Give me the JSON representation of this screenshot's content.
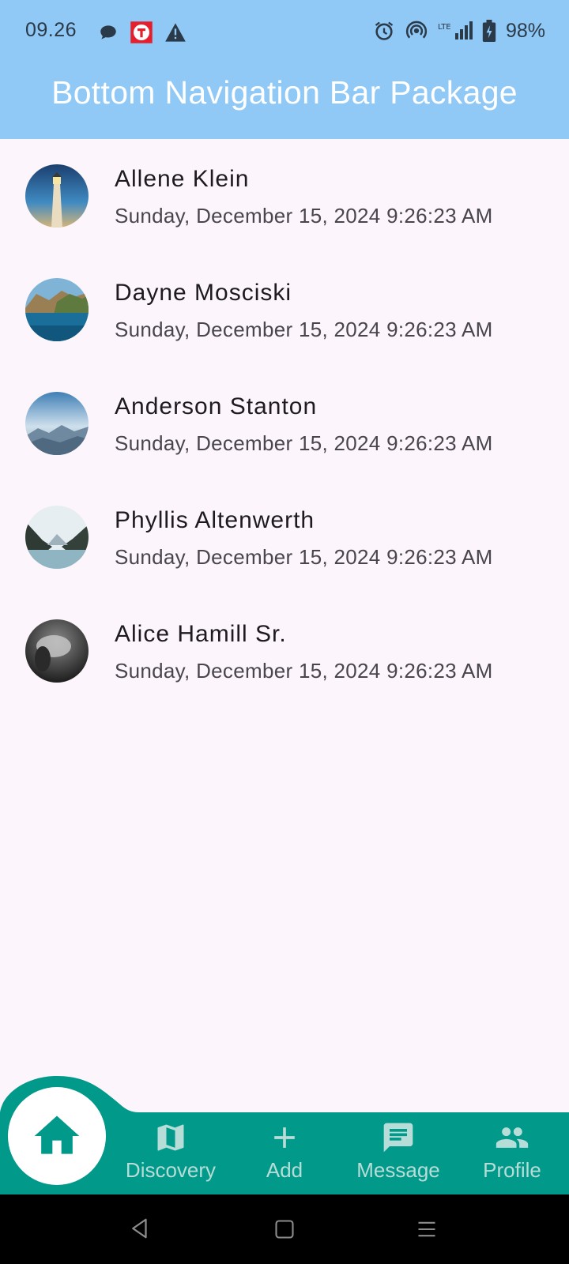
{
  "status_bar": {
    "time": "09.26",
    "battery": "98%",
    "network": "LTE"
  },
  "app_bar": {
    "title": "Bottom Navigation Bar Package",
    "background": "#90c8f6"
  },
  "list": {
    "items": [
      {
        "name": "Allene Klein",
        "date": "Sunday, December 15, 2024 9:26:23 AM",
        "avatar": "lighthouse-image"
      },
      {
        "name": "Dayne Mosciski",
        "date": "Sunday, December 15, 2024 9:26:23 AM",
        "avatar": "coast-image"
      },
      {
        "name": "Anderson Stanton",
        "date": "Sunday, December 15, 2024 9:26:23 AM",
        "avatar": "misty-mountains-image"
      },
      {
        "name": "Phyllis Altenwerth",
        "date": "Sunday, December 15, 2024 9:26:23 AM",
        "avatar": "mountain-lake-image"
      },
      {
        "name": "Alice Hamill Sr.",
        "date": "Sunday, December 15, 2024 9:26:23 AM",
        "avatar": "manatee-image"
      }
    ]
  },
  "bottom_nav": {
    "accent": "#00998a",
    "label_color": "#b6ddd7",
    "items": [
      {
        "label": "Home",
        "icon": "home-icon",
        "selected": true
      },
      {
        "label": "Discovery",
        "icon": "map-icon"
      },
      {
        "label": "Add",
        "icon": "plus-icon"
      },
      {
        "label": "Message",
        "icon": "message-icon"
      },
      {
        "label": "Profile",
        "icon": "people-icon"
      }
    ]
  },
  "system_nav": {
    "buttons": [
      "back-icon",
      "home-square-icon",
      "menu-icon"
    ]
  }
}
